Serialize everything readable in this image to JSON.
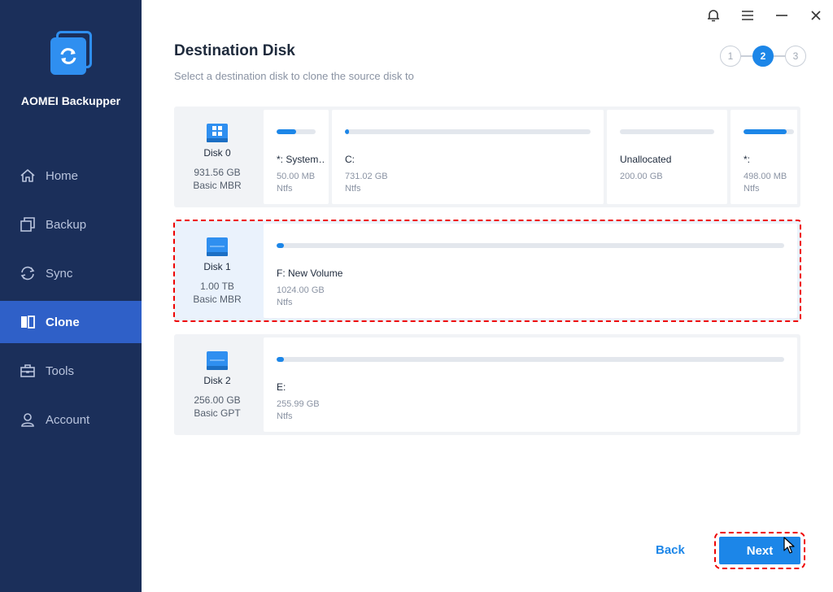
{
  "app": {
    "name": "AOMEI Backupper"
  },
  "nav": [
    {
      "label": "Home",
      "icon": "home-icon",
      "active": false
    },
    {
      "label": "Backup",
      "icon": "backup-icon",
      "active": false
    },
    {
      "label": "Sync",
      "icon": "sync-icon",
      "active": false
    },
    {
      "label": "Clone",
      "icon": "clone-icon",
      "active": true
    },
    {
      "label": "Tools",
      "icon": "tools-icon",
      "active": false
    },
    {
      "label": "Account",
      "icon": "account-icon",
      "active": false
    }
  ],
  "page": {
    "title": "Destination Disk",
    "subtitle": "Select a destination disk to clone the source disk to"
  },
  "steps": [
    "1",
    "2",
    "3"
  ],
  "current_step": 2,
  "disks": [
    {
      "name": "Disk 0",
      "size": "931.56 GB",
      "type": "Basic MBR",
      "selected": false,
      "partitions": [
        {
          "name": "*: System…",
          "size": "50.00 MB",
          "fs": "Ntfs",
          "used": 0.5
        },
        {
          "name": "C:",
          "size": "731.02 GB",
          "fs": "Ntfs",
          "used": 0.01
        },
        {
          "name": "Unallocated",
          "size": "200.00 GB",
          "fs": "",
          "used": 0
        },
        {
          "name": "*:",
          "size": "498.00 MB",
          "fs": "Ntfs",
          "used": 0.85
        }
      ]
    },
    {
      "name": "Disk 1",
      "size": "1.00 TB",
      "type": "Basic MBR",
      "selected": true,
      "partitions": [
        {
          "name": "F: New Volume",
          "size": "1024.00 GB",
          "fs": "Ntfs",
          "used": 0.005
        }
      ]
    },
    {
      "name": "Disk 2",
      "size": "256.00 GB",
      "type": "Basic GPT",
      "selected": false,
      "partitions": [
        {
          "name": "E:",
          "size": "255.99 GB",
          "fs": "Ntfs",
          "used": 0.005
        }
      ]
    }
  ],
  "buttons": {
    "back": "Back",
    "next": "Next"
  },
  "colors": {
    "sidebar": "#1b2f5a",
    "accent": "#1c86e8",
    "active_nav": "#2f60c8",
    "highlight": "#e00000"
  }
}
